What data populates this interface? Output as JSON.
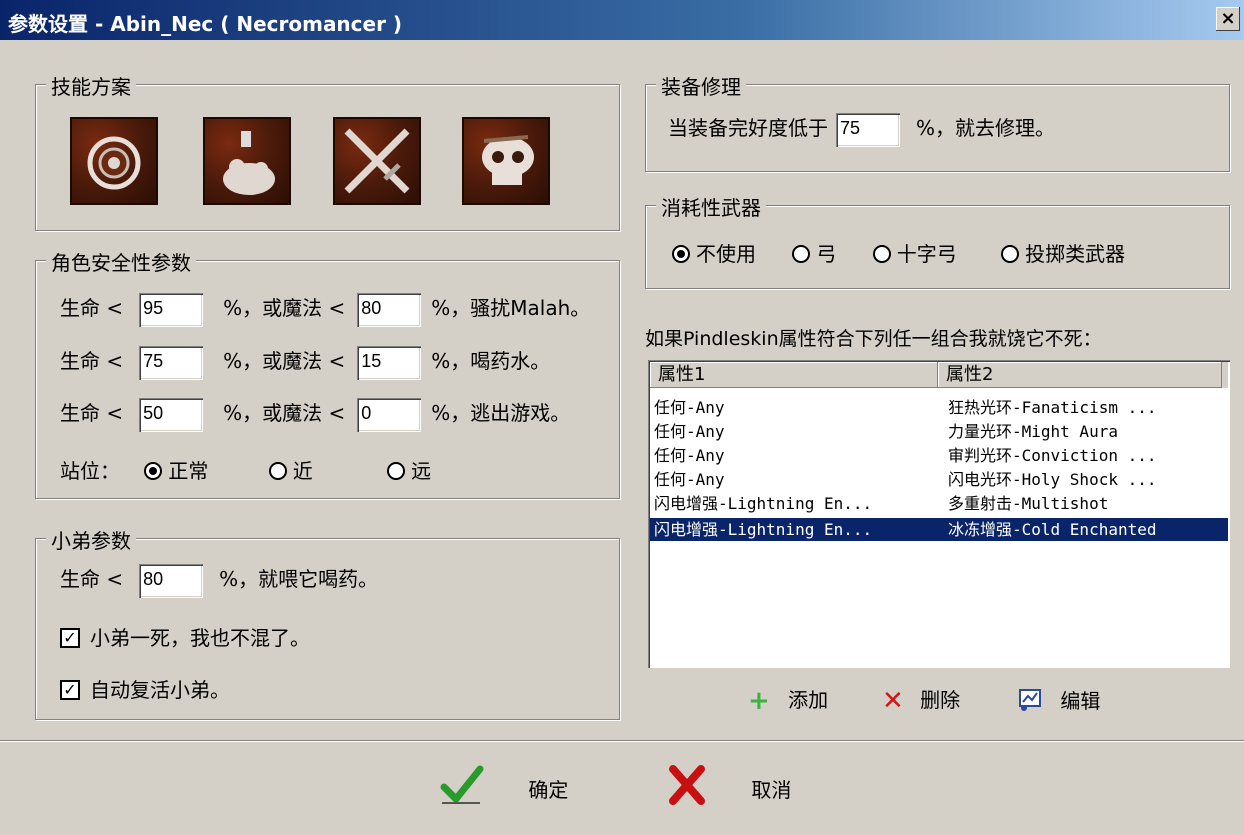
{
  "window": {
    "title": "参数设置 - Abin_Nec ( Necromancer )",
    "close": "×"
  },
  "skills": {
    "legend": "技能方案"
  },
  "safety": {
    "legend": "角色安全性参数",
    "rows": [
      {
        "life_label": "生命 <",
        "life": "95",
        "mid": "%，或魔法 <",
        "mana": "80",
        "suffix": "%，骚扰Malah。"
      },
      {
        "life_label": "生命 <",
        "life": "75",
        "mid": "%，或魔法 <",
        "mana": "15",
        "suffix": "%，喝药水。"
      },
      {
        "life_label": "生命 <",
        "life": "50",
        "mid": "%，或魔法 <",
        "mana": "0",
        "suffix": "%，逃出游戏。"
      }
    ],
    "stance_label": "站位：",
    "stances": [
      "正常",
      "近",
      "远"
    ]
  },
  "minion": {
    "legend": "小弟参数",
    "life_label": "生命 <",
    "life": "80",
    "suffix": "%，就喂它喝药。",
    "check1": "小弟一死，我也不混了。",
    "check2": "自动复活小弟。"
  },
  "repair": {
    "legend": "装备修理",
    "prefix": "当装备完好度低于",
    "value": "75",
    "suffix": "%，就去修理。"
  },
  "weapon": {
    "legend": "消耗性武器",
    "options": [
      "不使用",
      "弓",
      "十字弓",
      "投掷类武器"
    ]
  },
  "pindle": {
    "caption": "如果Pindleskin属性符合下列任一组合我就饶它不死：",
    "col1": "属性1",
    "col2": "属性2",
    "rows": [
      [
        "任何-Any",
        "狂热光环-Fanaticism ..."
      ],
      [
        "任何-Any",
        "力量光环-Might Aura"
      ],
      [
        "任何-Any",
        "审判光环-Conviction ..."
      ],
      [
        "任何-Any",
        "闪电光环-Holy Shock ..."
      ],
      [
        "闪电增强-Lightning En...",
        "多重射击-Multishot"
      ],
      [
        "闪电增强-Lightning En...",
        "冰冻增强-Cold Enchanted"
      ]
    ],
    "add": "添加",
    "delete": "删除",
    "edit": "编辑"
  },
  "footer": {
    "ok": "确定",
    "cancel": "取消"
  }
}
